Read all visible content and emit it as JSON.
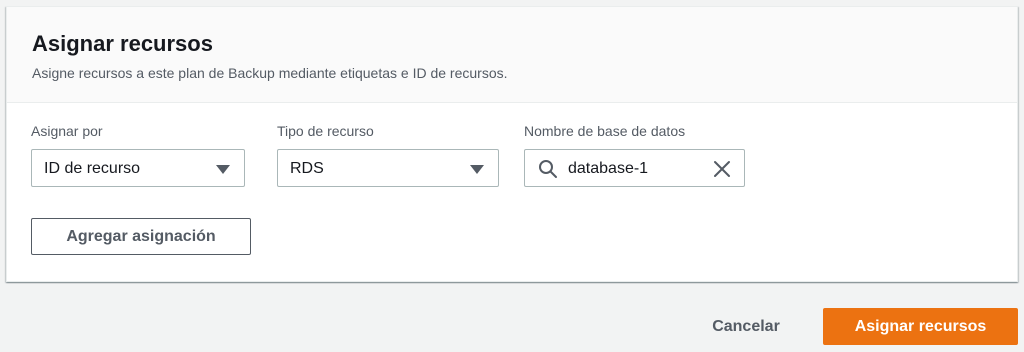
{
  "panel": {
    "title": "Asignar recursos",
    "subtitle": "Asigne recursos a este plan de Backup mediante etiquetas e ID de recursos."
  },
  "fields": {
    "assign_by": {
      "label": "Asignar por",
      "value": "ID de recurso"
    },
    "resource_type": {
      "label": "Tipo de recurso",
      "value": "RDS"
    },
    "database_name": {
      "label": "Nombre de base de datos",
      "value": "database-1"
    }
  },
  "buttons": {
    "add_assignment": "Agregar asignación",
    "cancel": "Cancelar",
    "submit": "Asignar recursos"
  },
  "icons": {
    "search": "search-icon",
    "clear": "close-icon",
    "dropdown": "caret-down-icon"
  },
  "colors": {
    "primary": "#ec7211",
    "border": "#aab7b8",
    "text_secondary": "#545b64"
  }
}
